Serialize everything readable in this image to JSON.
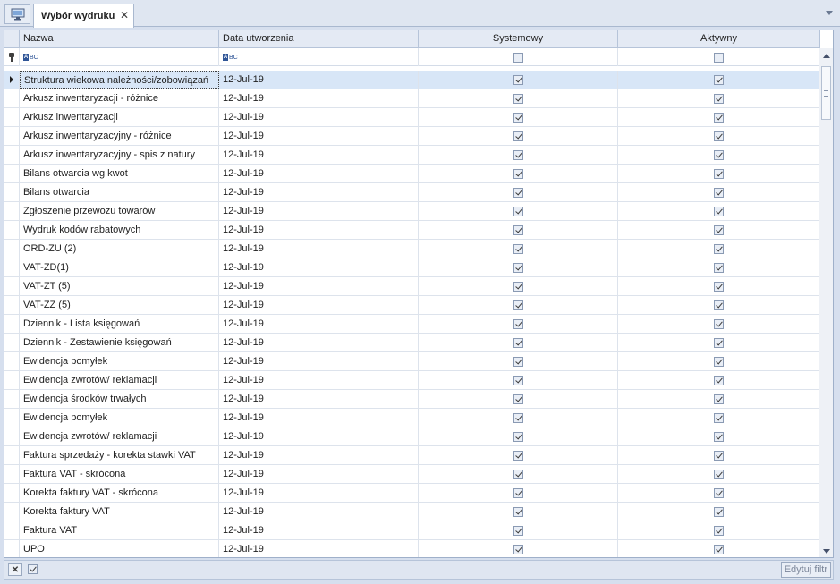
{
  "tab": {
    "title": "Wybór wydruku"
  },
  "icons": {
    "home": "monitor-icon",
    "close": "close-icon",
    "dropdown": "chevron-down-icon",
    "pin": "pin-icon",
    "text_filter": "abc-filter-icon"
  },
  "colors": {
    "selection": "#d8e6f7",
    "header_bg": "#e4eaf4",
    "frame_bg": "#d6dfee"
  },
  "columns": {
    "name": "Nazwa",
    "created": "Data utworzenia",
    "system": "Systemowy",
    "active": "Aktywny"
  },
  "filter_row": {
    "abc_a": "A",
    "abc_bc": "BC"
  },
  "rows": [
    {
      "name": "Struktura wiekowa należności/zobowiązań",
      "created": "12-Jul-19",
      "system": true,
      "active": true
    },
    {
      "name": "Arkusz inwentaryzacji - różnice",
      "created": "12-Jul-19",
      "system": true,
      "active": true
    },
    {
      "name": "Arkusz inwentaryzacji",
      "created": "12-Jul-19",
      "system": true,
      "active": true
    },
    {
      "name": "Arkusz inwentaryzacyjny - różnice",
      "created": "12-Jul-19",
      "system": true,
      "active": true
    },
    {
      "name": "Arkusz inwentaryzacyjny - spis z natury",
      "created": "12-Jul-19",
      "system": true,
      "active": true
    },
    {
      "name": "Bilans otwarcia wg kwot",
      "created": "12-Jul-19",
      "system": true,
      "active": true
    },
    {
      "name": "Bilans otwarcia",
      "created": "12-Jul-19",
      "system": true,
      "active": true
    },
    {
      "name": "Zgłoszenie przewozu towarów",
      "created": "12-Jul-19",
      "system": true,
      "active": true
    },
    {
      "name": "Wydruk kodów rabatowych",
      "created": "12-Jul-19",
      "system": true,
      "active": true
    },
    {
      "name": "ORD-ZU (2)",
      "created": "12-Jul-19",
      "system": true,
      "active": true
    },
    {
      "name": "VAT-ZD(1)",
      "created": "12-Jul-19",
      "system": true,
      "active": true
    },
    {
      "name": "VAT-ZT (5)",
      "created": "12-Jul-19",
      "system": true,
      "active": true
    },
    {
      "name": "VAT-ZZ (5)",
      "created": "12-Jul-19",
      "system": true,
      "active": true
    },
    {
      "name": "Dziennik - Lista księgowań",
      "created": "12-Jul-19",
      "system": true,
      "active": true
    },
    {
      "name": "Dziennik - Zestawienie księgowań",
      "created": "12-Jul-19",
      "system": true,
      "active": true
    },
    {
      "name": "Ewidencja pomyłek",
      "created": "12-Jul-19",
      "system": true,
      "active": true
    },
    {
      "name": "Ewidencja zwrotów/ reklamacji",
      "created": "12-Jul-19",
      "system": true,
      "active": true
    },
    {
      "name": "Ewidencja środków trwałych",
      "created": "12-Jul-19",
      "system": true,
      "active": true
    },
    {
      "name": "Ewidencja pomyłek",
      "created": "12-Jul-19",
      "system": true,
      "active": true
    },
    {
      "name": "Ewidencja zwrotów/ reklamacji",
      "created": "12-Jul-19",
      "system": true,
      "active": true
    },
    {
      "name": "Faktura sprzedaży - korekta stawki VAT",
      "created": "12-Jul-19",
      "system": true,
      "active": true
    },
    {
      "name": "Faktura VAT - skrócona",
      "created": "12-Jul-19",
      "system": true,
      "active": true
    },
    {
      "name": "Korekta faktury VAT - skrócona",
      "created": "12-Jul-19",
      "system": true,
      "active": true
    },
    {
      "name": "Korekta faktury VAT",
      "created": "12-Jul-19",
      "system": true,
      "active": true
    },
    {
      "name": "Faktura VAT",
      "created": "12-Jul-19",
      "system": true,
      "active": true
    },
    {
      "name": "UPO",
      "created": "12-Jul-19",
      "system": true,
      "active": true
    }
  ],
  "bottom": {
    "clear_label": "✕",
    "edit_filter": "Edytuj filtr",
    "filter_enabled": true
  }
}
